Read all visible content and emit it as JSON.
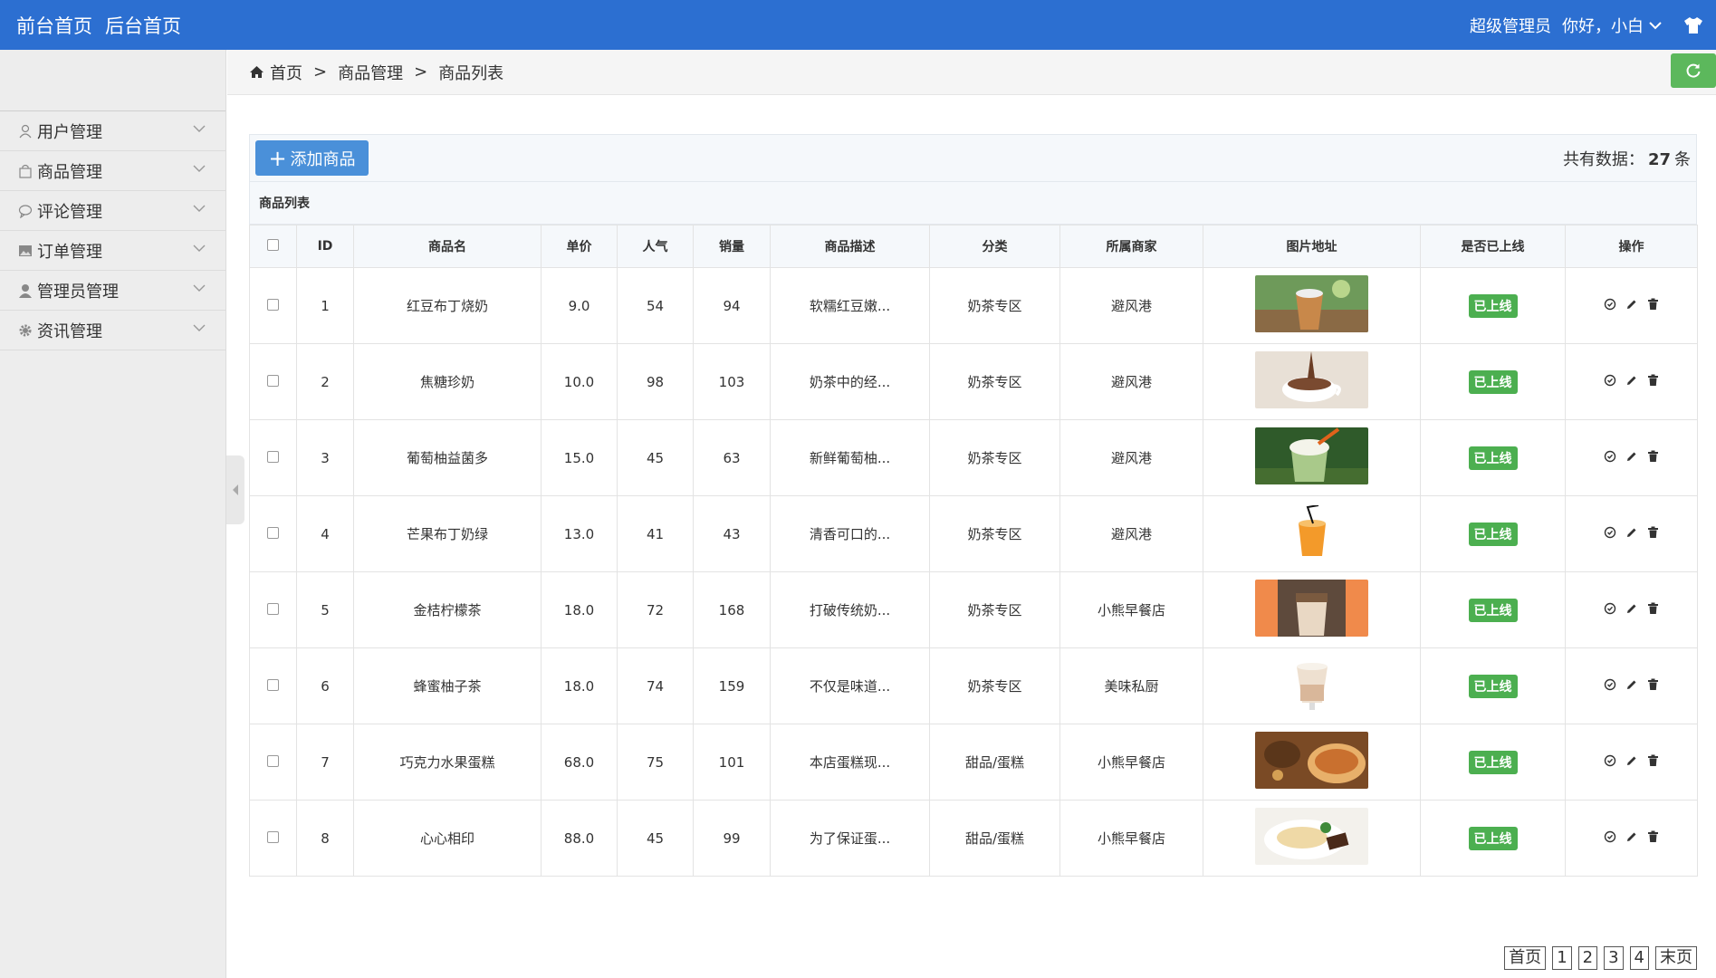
{
  "topbar": {
    "front_home": "前台首页",
    "back_home": "后台首页",
    "role": "超级管理员",
    "greeting": "你好，小白"
  },
  "sidebar": {
    "items": [
      {
        "label": "用户管理",
        "icon": "user-icon"
      },
      {
        "label": "商品管理",
        "icon": "bag-icon"
      },
      {
        "label": "评论管理",
        "icon": "comment-icon"
      },
      {
        "label": "订单管理",
        "icon": "image-icon"
      },
      {
        "label": "管理员管理",
        "icon": "person-icon"
      },
      {
        "label": "资讯管理",
        "icon": "gear-icon"
      }
    ]
  },
  "breadcrumb": {
    "home": "首页",
    "sep": ">",
    "level1": "商品管理",
    "level2": "商品列表"
  },
  "toolbar": {
    "add_label": "添加商品",
    "total_prefix": "共有数据：",
    "total_count": "27",
    "total_suffix": "条"
  },
  "list_title": "商品列表",
  "table": {
    "headers": [
      "ID",
      "商品名",
      "单价",
      "人气",
      "销量",
      "商品描述",
      "分类",
      "所属商家",
      "图片地址",
      "是否已上线",
      "操作"
    ],
    "rows": [
      {
        "id": "1",
        "name": "红豆布丁烧奶",
        "price": "9.0",
        "popularity": "54",
        "sales": "94",
        "desc": "软糯红豆嫩...",
        "category": "奶茶专区",
        "merchant": "避风港",
        "status": "已上线"
      },
      {
        "id": "2",
        "name": "焦糖珍奶",
        "price": "10.0",
        "popularity": "98",
        "sales": "103",
        "desc": "奶茶中的经...",
        "category": "奶茶专区",
        "merchant": "避风港",
        "status": "已上线"
      },
      {
        "id": "3",
        "name": "葡萄柚益菌多",
        "price": "15.0",
        "popularity": "45",
        "sales": "63",
        "desc": "新鲜葡萄柚...",
        "category": "奶茶专区",
        "merchant": "避风港",
        "status": "已上线"
      },
      {
        "id": "4",
        "name": "芒果布丁奶绿",
        "price": "13.0",
        "popularity": "41",
        "sales": "43",
        "desc": "清香可口的...",
        "category": "奶茶专区",
        "merchant": "避风港",
        "status": "已上线"
      },
      {
        "id": "5",
        "name": "金桔柠檬茶",
        "price": "18.0",
        "popularity": "72",
        "sales": "168",
        "desc": "打破传统奶...",
        "category": "奶茶专区",
        "merchant": "小熊早餐店",
        "status": "已上线"
      },
      {
        "id": "6",
        "name": "蜂蜜柚子茶",
        "price": "18.0",
        "popularity": "74",
        "sales": "159",
        "desc": "不仅是味道...",
        "category": "奶茶专区",
        "merchant": "美味私厨",
        "status": "已上线"
      },
      {
        "id": "7",
        "name": "巧克力水果蛋糕",
        "price": "68.0",
        "popularity": "75",
        "sales": "101",
        "desc": "本店蛋糕现...",
        "category": "甜品/蛋糕",
        "merchant": "小熊早餐店",
        "status": "已上线"
      },
      {
        "id": "8",
        "name": "心心相印",
        "price": "88.0",
        "popularity": "45",
        "sales": "99",
        "desc": "为了保证蛋...",
        "category": "甜品/蛋糕",
        "merchant": "小熊早餐店",
        "status": "已上线"
      }
    ]
  },
  "pager": {
    "first": "首页",
    "pages": [
      "1",
      "2",
      "3",
      "4"
    ],
    "last": "末页"
  },
  "colors": {
    "topbar": "#2c6fd1",
    "add_button": "#4a90d9",
    "refresh_button": "#5cb85c",
    "badge": "#4caf50"
  }
}
